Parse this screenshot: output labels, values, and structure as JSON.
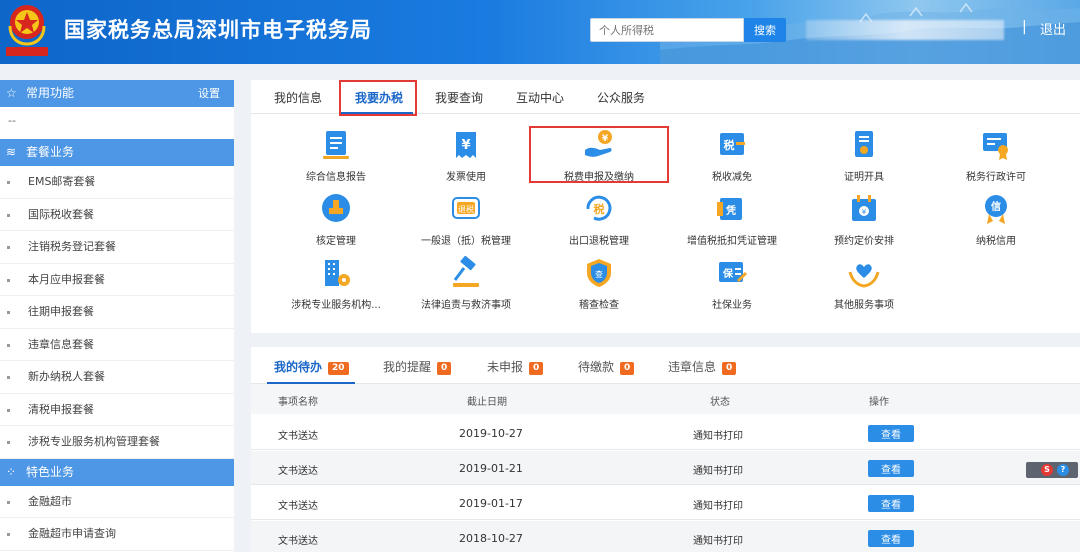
{
  "header": {
    "title": "国家税务总局深圳市电子税务局",
    "search_placeholder": "个人所得税",
    "search_button": "搜索",
    "separator": "|",
    "logout": "退出"
  },
  "sidebar": {
    "common": {
      "label": "常用功能",
      "setting": "设置",
      "empty": "--"
    },
    "package": {
      "label": "套餐业务",
      "items": [
        "EMS邮寄套餐",
        "国际税收套餐",
        "注销税务登记套餐",
        "本月应申报套餐",
        "往期申报套餐",
        "违章信息套餐",
        "新办纳税人套餐",
        "清税申报套餐",
        "涉税专业服务机构管理套餐"
      ]
    },
    "special": {
      "label": "特色业务",
      "items": [
        "金融超市",
        "金融超市申请查询"
      ]
    }
  },
  "top_tabs": [
    "我的信息",
    "我要办税",
    "我要查询",
    "互动中心",
    "公众服务"
  ],
  "services": [
    {
      "label": "综合信息报告",
      "icon": "report-icon"
    },
    {
      "label": "发票使用",
      "icon": "invoice-icon"
    },
    {
      "label": "税费申报及缴纳",
      "icon": "tax-payment-icon"
    },
    {
      "label": "税收减免",
      "icon": "tax-relief-icon"
    },
    {
      "label": "证明开具",
      "icon": "certificate-icon"
    },
    {
      "label": "税务行政许可",
      "icon": "license-icon"
    },
    {
      "label": "核定管理",
      "icon": "stamp-icon"
    },
    {
      "label": "一般退（抵）税管理",
      "icon": "refund-icon"
    },
    {
      "label": "出口退税管理",
      "icon": "export-refund-icon"
    },
    {
      "label": "增值税抵扣凭证管理",
      "icon": "voucher-icon"
    },
    {
      "label": "预约定价安排",
      "icon": "calendar-icon"
    },
    {
      "label": "纳税信用",
      "icon": "credit-icon"
    },
    {
      "label": "涉税专业服务机构...",
      "icon": "building-icon"
    },
    {
      "label": "法律追责与救济事项",
      "icon": "gavel-icon"
    },
    {
      "label": "稽查检查",
      "icon": "shield-icon"
    },
    {
      "label": "社保业务",
      "icon": "social-security-icon"
    },
    {
      "label": "其他服务事项",
      "icon": "heart-hands-icon"
    }
  ],
  "task_tabs": [
    {
      "label": "我的待办",
      "count": "20"
    },
    {
      "label": "我的提醒",
      "count": "0"
    },
    {
      "label": "未申报",
      "count": "0"
    },
    {
      "label": "待缴款",
      "count": "0"
    },
    {
      "label": "违章信息",
      "count": "0"
    }
  ],
  "table": {
    "columns": [
      "事项名称",
      "截止日期",
      "状态",
      "操作"
    ],
    "rows": [
      {
        "name": "文书送达",
        "date": "2019-10-27",
        "status": "通知书打印",
        "action": "查看"
      },
      {
        "name": "文书送达",
        "date": "2019-01-21",
        "status": "通知书打印",
        "action": "查看"
      },
      {
        "name": "文书送达",
        "date": "2019-01-17",
        "status": "通知书打印",
        "action": "查看"
      },
      {
        "name": "文书送达",
        "date": "2018-10-27",
        "status": "通知书打印",
        "action": "查看"
      }
    ]
  },
  "widget": {
    "s": "S",
    "q": "?"
  },
  "colors": {
    "brand": "#1b67c8",
    "icon_blue": "#2b8de6",
    "icon_orange": "#f5a623",
    "badge": "#f06a1f",
    "highlight": "#e53935"
  }
}
